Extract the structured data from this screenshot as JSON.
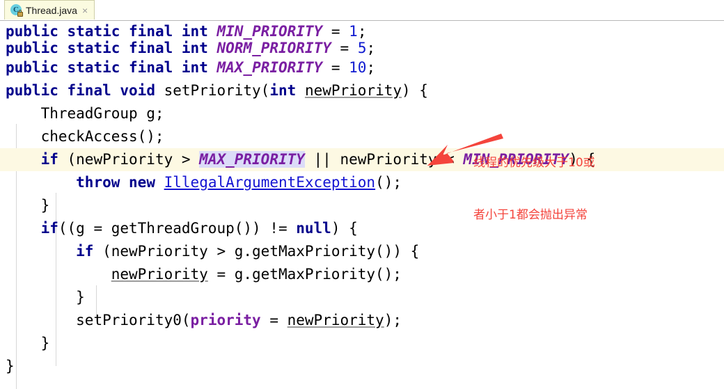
{
  "tab": {
    "icon": "java-class-icon",
    "title": "Thread.java",
    "close_label": "×"
  },
  "annotation": {
    "line1": "线程的优先级大于10或",
    "line2": "者小于1都会抛出异常",
    "color": "#f4443c",
    "arrow": "red-arrow-icon"
  },
  "colors": {
    "keyword": "#00008c",
    "number": "#0f1ad0",
    "constant": "#7a1fa2",
    "field": "#7a1fa2",
    "link": "#1414d2",
    "current_line_bg": "#fdf9e3",
    "selection_bg": "#dcdcf8",
    "tab_bg": "#fbfbe0",
    "editor_bg": "#ffffff"
  },
  "code": {
    "l1": {
      "kw_public": "public",
      "kw_static": "static",
      "kw_final": "final",
      "kw_int": "int",
      "const": "MIN_PRIORITY",
      "eq": " = ",
      "num": "1",
      "semi": ";"
    },
    "l2": {
      "kw_public": "public",
      "kw_static": "static",
      "kw_final": "final",
      "kw_int": "int",
      "const": "NORM_PRIORITY",
      "eq": " = ",
      "num": "5",
      "semi": ";"
    },
    "l3": {
      "kw_public": "public",
      "kw_static": "static",
      "kw_final": "final",
      "kw_int": "int",
      "const": "MAX_PRIORITY",
      "eq": " = ",
      "num": "10",
      "semi": ";"
    },
    "l4": {
      "kw_public": "public",
      "kw_final": "final",
      "kw_void": "void",
      "method": " setPriority(",
      "kw_int": "int",
      "param": "newPriority",
      "tail": ") {"
    },
    "l5": {
      "text": "    ThreadGroup g;"
    },
    "l6": {
      "text": "    checkAccess();"
    },
    "l7": {
      "indent": "    ",
      "kw_if": "if",
      "open": " (newPriority > ",
      "const_max": "MAX_PRIORITY",
      "mid": " || newPriority < ",
      "const_min": "MIN_PRIORITY",
      "tail": ") {"
    },
    "l8": {
      "indent": "        ",
      "kw_throw": "throw",
      "kw_new": "new",
      "type": "IllegalArgumentException",
      "tail": "();"
    },
    "l9": {
      "text": "    }"
    },
    "l10": {
      "indent": "    ",
      "kw_if": "if",
      "open": "((g = getThreadGroup()) != ",
      "kw_null": "null",
      "tail": ") {"
    },
    "l11": {
      "indent": "        ",
      "kw_if": "if",
      "tail": " (newPriority > g.getMaxPriority()) {"
    },
    "l12": {
      "indent": "            ",
      "param": "newPriority",
      "tail": " = g.getMaxPriority();"
    },
    "l13": {
      "text": "        }"
    },
    "l14": {
      "indent": "        ",
      "call": "setPriority0(",
      "field": "priority",
      "eq": " = ",
      "param": "newPriority",
      "tail": ");"
    },
    "l15": {
      "text": "    }"
    },
    "l16": {
      "text": "}"
    }
  }
}
